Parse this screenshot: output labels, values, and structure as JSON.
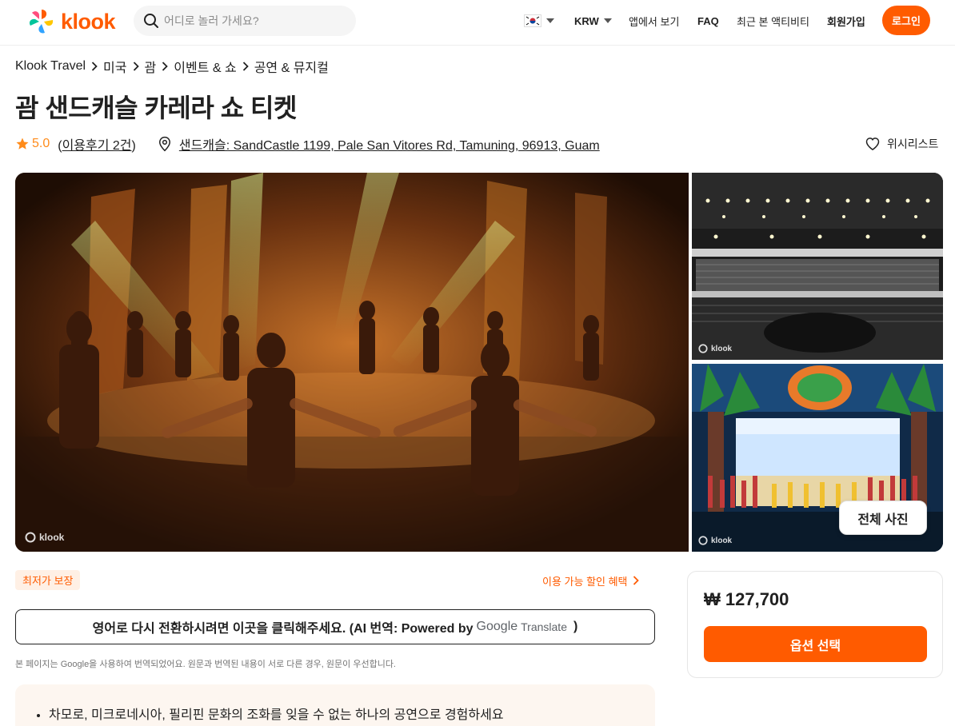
{
  "header": {
    "logo_text": "klook",
    "search_placeholder": "어디로 놀러 가세요?",
    "currency": "KRW",
    "app_link": "앱에서 보기",
    "faq": "FAQ",
    "recent": "최근 본 액티비티",
    "signup": "회원가입",
    "login": "로그인"
  },
  "breadcrumb": [
    "Klook Travel",
    "미국",
    "괌",
    "이벤트 & 쇼",
    "공연 & 뮤지컬"
  ],
  "title": "괌 샌드캐슬 카레라 쇼 티켓",
  "meta": {
    "rating": "5.0",
    "reviews_open": "(",
    "reviews_label": "이용후기 2건",
    "reviews_close": ")",
    "location": "샌드캐슬: SandCastle 1199, Pale San Vitores Rd, Tamuning, 96913, Guam",
    "wishlist": "위시리스트"
  },
  "gallery": {
    "watermark": "klook",
    "all_photos": "전체 사진"
  },
  "offers": {
    "best_price": "최저가 보장",
    "deals": "이용 가능 할인 혜택"
  },
  "translate": {
    "button_text": "영어로 다시 전환하시려면 이곳을 클릭해주세요. (AI 번역: Powered by",
    "google": "Google",
    "translate_word": "Translate",
    "close_paren": ")",
    "note": "본 페이지는 Google을 사용하여 번역되었어요. 원문과 번역된 내용이 서로 다른 경우, 원문이 우선합니다."
  },
  "highlights": [
    "차모로, 미크로네시아, 필리핀 문화의 조화를 잊을 수 없는 하나의 공연으로 경험하세요"
  ],
  "booking": {
    "price": "₩ 127,700",
    "select_option": "옵션 선택"
  },
  "colors": {
    "brand": "#ff5b00",
    "star": "#ff8b1a"
  }
}
